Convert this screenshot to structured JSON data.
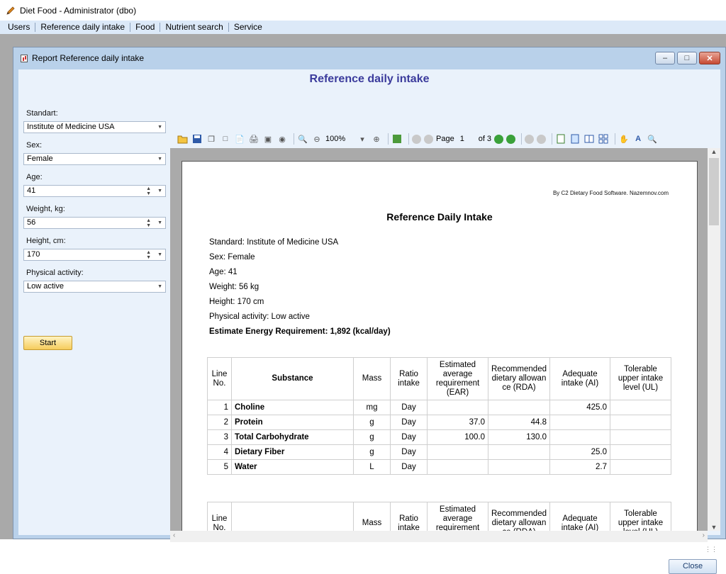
{
  "window": {
    "title": "Diet Food - Administrator (dbo)"
  },
  "menu": [
    "Users",
    "Reference daily intake",
    "Food",
    "Nutrient search",
    "Service"
  ],
  "child": {
    "title": "Report Reference daily intake",
    "heading": "Reference daily intake"
  },
  "form": {
    "standard_label": "Standart:",
    "standard_value": "Institute of Medicine USA",
    "sex_label": "Sex:",
    "sex_value": "Female",
    "age_label": "Age:",
    "age_value": "41",
    "weight_label": "Weight, kg:",
    "weight_value": "56",
    "height_label": "Height, cm:",
    "height_value": "170",
    "activity_label": "Physical activity:",
    "activity_value": "Low active",
    "start_label": "Start"
  },
  "toolbar": {
    "zoom": "100%",
    "page_label": "Page",
    "page_value": "1",
    "page_of": "of 3"
  },
  "report": {
    "credit": "By C2 Dietary Food Software. Nazemnov.com",
    "title": "Reference Daily Intake",
    "lines": [
      "Standard: Institute of Medicine USA",
      "Sex: Female",
      "Age: 41",
      "Weight: 56 kg",
      "Height: 170 cm",
      "Physical activity: Low active"
    ],
    "energy": "Estimate Energy Requirement: 1,892 (kcal/day)",
    "columns": [
      "Line No.",
      "Substance",
      "Mass",
      "Ratio intake",
      "Estimated average requirement (EAR)",
      "Recommended dietary allowance (RDA)",
      "Adequate intake (AI)",
      "Tolerable upper intake level (UL)"
    ],
    "rows": [
      {
        "no": "1",
        "substance": "Choline",
        "mass": "mg",
        "ratio": "Day",
        "ear": "",
        "rda": "",
        "ai": "425.0",
        "ul": ""
      },
      {
        "no": "2",
        "substance": "Protein",
        "mass": "g",
        "ratio": "Day",
        "ear": "37.0",
        "rda": "44.8",
        "ai": "",
        "ul": ""
      },
      {
        "no": "3",
        "substance": "Total Carbohydrate",
        "mass": "g",
        "ratio": "Day",
        "ear": "100.0",
        "rda": "130.0",
        "ai": "",
        "ul": ""
      },
      {
        "no": "4",
        "substance": "Dietary Fiber",
        "mass": "g",
        "ratio": "Day",
        "ear": "",
        "rda": "",
        "ai": "25.0",
        "ul": ""
      },
      {
        "no": "5",
        "substance": "Water",
        "mass": "L",
        "ratio": "Day",
        "ear": "",
        "rda": "",
        "ai": "2.7",
        "ul": ""
      }
    ]
  },
  "footer": {
    "close_label": "Close"
  }
}
